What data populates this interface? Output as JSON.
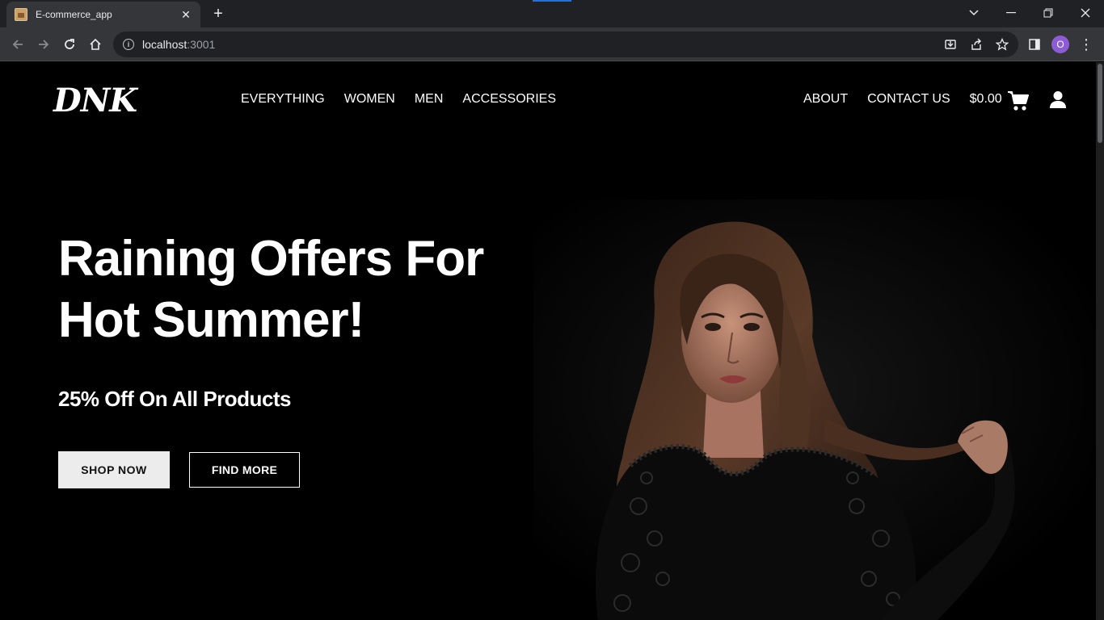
{
  "browser": {
    "tab_title": "E-commerce_app",
    "new_tab_symbol": "+",
    "url_host": "localhost",
    "url_port": ":3001",
    "profile_initial": "O"
  },
  "site": {
    "logo": "DNK",
    "nav_left": [
      "EVERYTHING",
      "WOMEN",
      "MEN",
      "ACCESSORIES"
    ],
    "nav_right": {
      "about": "ABOUT",
      "contact": "CONTACT US",
      "cart_total": "$0.00"
    },
    "icons": {
      "cart": "cart-icon",
      "user": "user-icon"
    }
  },
  "hero": {
    "title_line1": "Raining Offers For",
    "title_line2": "Hot Summer!",
    "subtitle": "25% Off On All Products",
    "shop_button": "SHOP NOW",
    "find_button": "FIND MORE"
  },
  "colors": {
    "page_bg": "#000000",
    "text": "#ffffff",
    "primary_button_bg": "#ececec",
    "tab_accent": "#1a73e8",
    "profile_bg": "#8e5bd6"
  }
}
